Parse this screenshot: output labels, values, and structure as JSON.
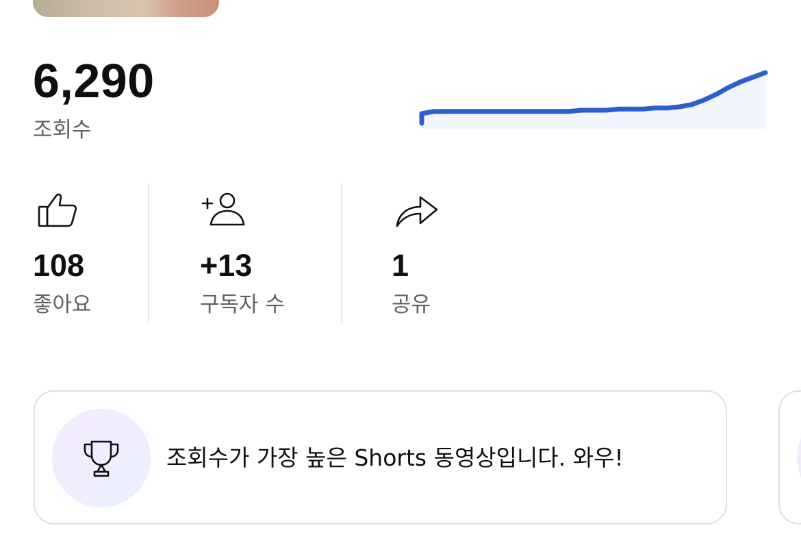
{
  "views": {
    "value": "6,290",
    "label": "조회수"
  },
  "sparkline": {
    "line_color": "#2a5fd1",
    "fill_color": "#f1f5fd",
    "values": [
      0,
      2,
      2,
      2,
      2,
      2,
      2,
      2,
      2,
      2,
      2,
      2,
      2,
      3,
      3,
      3,
      4,
      4,
      4,
      5,
      5,
      6,
      8,
      12,
      17,
      23,
      28,
      32,
      36
    ]
  },
  "stats": [
    {
      "icon": "thumbs-up-icon",
      "value": "108",
      "label": "좋아요"
    },
    {
      "icon": "add-subscriber-icon",
      "value": "+13",
      "label": "구독자 수"
    },
    {
      "icon": "share-arrow-icon",
      "value": "1",
      "label": "공유"
    }
  ],
  "highlight_card": {
    "icon": "trophy-icon",
    "text": "조회수가 가장 높은 Shorts 동영상입니다. 와우!"
  }
}
